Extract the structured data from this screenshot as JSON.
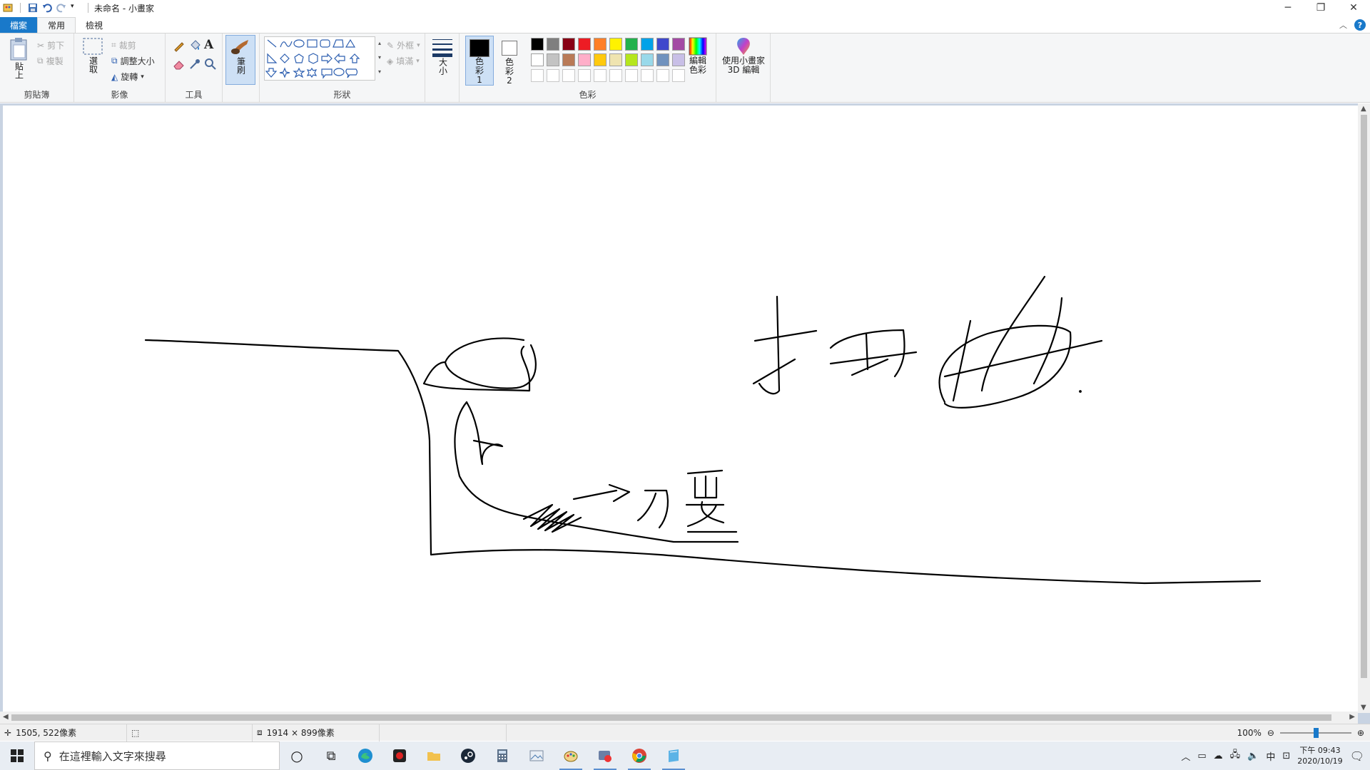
{
  "window": {
    "title": "未命名 - 小畫家"
  },
  "tabs": {
    "file": "檔案",
    "home": "常用",
    "view": "檢視"
  },
  "clipboard": {
    "paste": "貼上",
    "cut": "剪下",
    "copy": "複製",
    "label": "剪貼簿"
  },
  "image": {
    "select": "選取",
    "crop": "裁剪",
    "resize": "調整大小",
    "rotate": "旋轉",
    "label": "影像"
  },
  "tools": {
    "label": "工具",
    "text_tool": "A"
  },
  "brushes": {
    "label": "筆刷"
  },
  "shapes": {
    "label": "形狀",
    "outline": "外框",
    "fill": "填滿"
  },
  "size": {
    "label": "大小"
  },
  "colors": {
    "color1": "色彩 1",
    "color2": "色彩 2",
    "edit": "編輯色彩",
    "label": "色彩",
    "color1_value": "#000000",
    "color2_value": "#ffffff",
    "palette_row1": [
      "#000000",
      "#7f7f7f",
      "#880015",
      "#ed1c24",
      "#ff7f27",
      "#fff200",
      "#22b14c",
      "#00a2e8",
      "#3f48cc",
      "#a349a4"
    ],
    "palette_row2": [
      "#ffffff",
      "#c3c3c3",
      "#b97a57",
      "#ffaec9",
      "#ffc90e",
      "#efe4b0",
      "#b5e61d",
      "#99d9ea",
      "#7092be",
      "#c8bfe7"
    ]
  },
  "paint3d": {
    "label": "使用小畫家 3D 編輯"
  },
  "status": {
    "cursor_pos": "1505, 522像素",
    "canvas_size": "1914 × 899像素",
    "zoom": "100%",
    "zoom_fraction": 0.5
  },
  "taskbar": {
    "search_placeholder": "在這裡輸入文字來搜尋",
    "ime": "中",
    "time": "下午 09:43",
    "date": "2020/10/19"
  }
}
